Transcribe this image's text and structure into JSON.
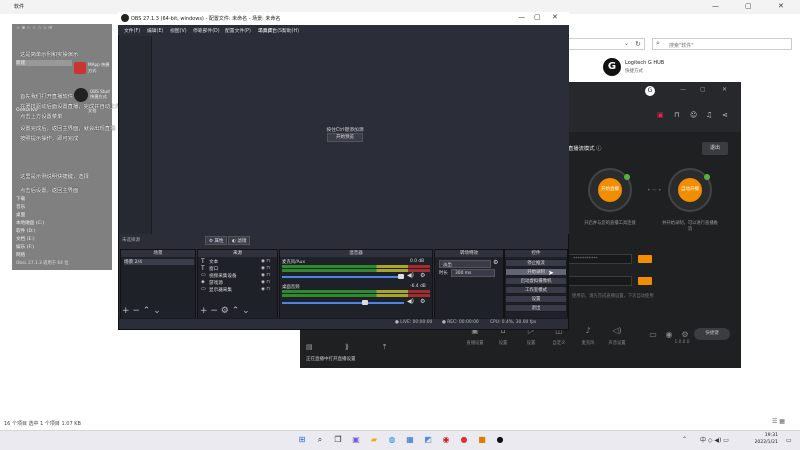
{
  "explorer": {
    "title": "软件",
    "search_placeholder": "搜索\"软件\"",
    "item_name": "Logitech G HUB",
    "item_type": "快捷方式",
    "status": "16 个项目   选中 1 个项目  1.07 KB"
  },
  "left_panel": {
    "toolbar": "☆ ⊕ ☆   ☆ ☆ ☆ ✉",
    "rows": [
      "新建",
      "复制",
      "粘贴",
      "重命名",
      "删除",
      "属性",
      "OneDrive",
      "此电脑",
      "3D 对象",
      "视频",
      "图片",
      "文档",
      "下载",
      "音乐",
      "桌面",
      "本地磁盘 (C:)",
      "软件 (D:)",
      "文档 (E:)",
      "娱乐 (F:)",
      "资料 (G:)",
      "网络"
    ],
    "thumb_labels": [
      "MApp 快捷方式",
      "OBS Stud 快捷方式",
      "文档"
    ],
    "verified": "✓ 已认证",
    "version": "ObsL 27.1.3 适用于 64 位"
  },
  "overlay_lines": [
    "这是简单示例和实操演示",
    "首先我们打开直播软件",
    "在罗技驱动后面设置直播，完成并自动上传视频直播",
    "点击上方设置菜单",
    "设置完成后，返回主界面，就会出现直播",
    "按照提示操作，即可完成",
    "完成以后，选择可以开始直播",
    "这里是示例说明快捷键，选择",
    "点击后设置，返回主界面"
  ],
  "ghub": {
    "mode": "直播流模式 ⓘ",
    "exit": "退出",
    "btn_left": "开始直播",
    "btn_right": "自动开播",
    "sub_left": "开启并与您的直播工具连接",
    "sub_right": "并开始录制，可以进行直播推流",
    "field1": "***********",
    "field2": "",
    "hint": "使用前，请先完成直播设置，下次自动使用",
    "bottom_items": [
      "直播设置",
      "设置",
      "设置",
      "自定义",
      "直播",
      "麦克风",
      "声音设置",
      "计时器",
      "设置",
      "预设",
      "1.0.0.0",
      "更多",
      "快捷键"
    ],
    "bottom_left": "正在直播中打开直播设置",
    "action": "快捷键",
    "level": "1"
  },
  "obs": {
    "title": "OBS 27.1.3 (64-bit, windows) - 配置文件: 未命名 - 场景: 未命名",
    "menu": [
      "文件(F)",
      "编辑(E)",
      "视图(V)",
      "停靠部件(D)",
      "配置文件(P)",
      "场景集合(S)",
      "工具(T)",
      "帮助(H)"
    ],
    "preview_text": "按住Ctrl键添加源",
    "preview_button": "开始预览",
    "no_source": "未选择源",
    "prop_button": "属性",
    "filter_button": "滤镜",
    "docks": {
      "scenes": "场景",
      "sources": "来源",
      "mixer": "混音器",
      "transitions": "转场特效",
      "controls": "控件"
    },
    "scene_items": [
      "场景 2/4"
    ],
    "sources": [
      "文本",
      "窗口",
      "视频采集设备",
      "游戏源",
      "显示器采集"
    ],
    "mixer": [
      {
        "name": "麦克风/Aux",
        "db": "0.0 dB"
      },
      {
        "name": "桌面音频",
        "db": "-6.4 dB"
      }
    ],
    "transition": "淡出",
    "duration_label": "时长",
    "duration_value": "300 ms",
    "controls": [
      "停止推流",
      "开始录制",
      "启动虚拟摄像机",
      "工作室模式",
      "设置",
      "退出"
    ],
    "status": [
      "● LIVE: 00:00:00",
      "● REC: 00:00:00",
      "CPU: 0.4%, 30.00 fps"
    ]
  },
  "taskbar": {
    "time": "19:31",
    "date": "2022/1/21"
  }
}
